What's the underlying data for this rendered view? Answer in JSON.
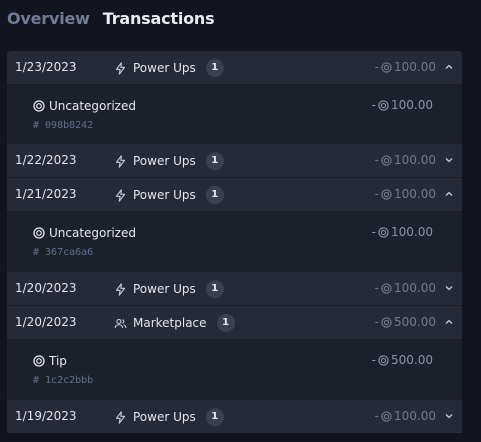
{
  "tabs": [
    {
      "label": "Overview"
    },
    {
      "label": "Transactions"
    }
  ],
  "transactions": [
    {
      "date": "1/23/2023",
      "category": "Power Ups",
      "count": "1",
      "amount": "100.00",
      "expanded": true,
      "detail": {
        "category": "Uncategorized",
        "hash": "# 098b8242",
        "amount": "100.00"
      }
    },
    {
      "date": "1/22/2023",
      "category": "Power Ups",
      "count": "1",
      "amount": "100.00",
      "expanded": false
    },
    {
      "date": "1/21/2023",
      "category": "Power Ups",
      "count": "1",
      "amount": "100.00",
      "expanded": true,
      "detail": {
        "category": "Uncategorized",
        "hash": "# 367ca6a6",
        "amount": "100.00"
      }
    },
    {
      "date": "1/20/2023",
      "category": "Power Ups",
      "count": "1",
      "amount": "100.00",
      "expanded": false
    },
    {
      "date": "1/20/2023",
      "category": "Marketplace",
      "count": "1",
      "amount": "500.00",
      "expanded": true,
      "detail": {
        "category": "Tip",
        "hash": "# 1c2c2bbb",
        "amount": "500.00"
      }
    },
    {
      "date": "1/19/2023",
      "category": "Power Ups",
      "count": "1",
      "amount": "100.00",
      "expanded": false
    }
  ],
  "amount_prefix": "-",
  "colors": {
    "background": "#12151d",
    "row": "#262a36",
    "detail": "#1c202b",
    "muted": "#6f7a90"
  }
}
